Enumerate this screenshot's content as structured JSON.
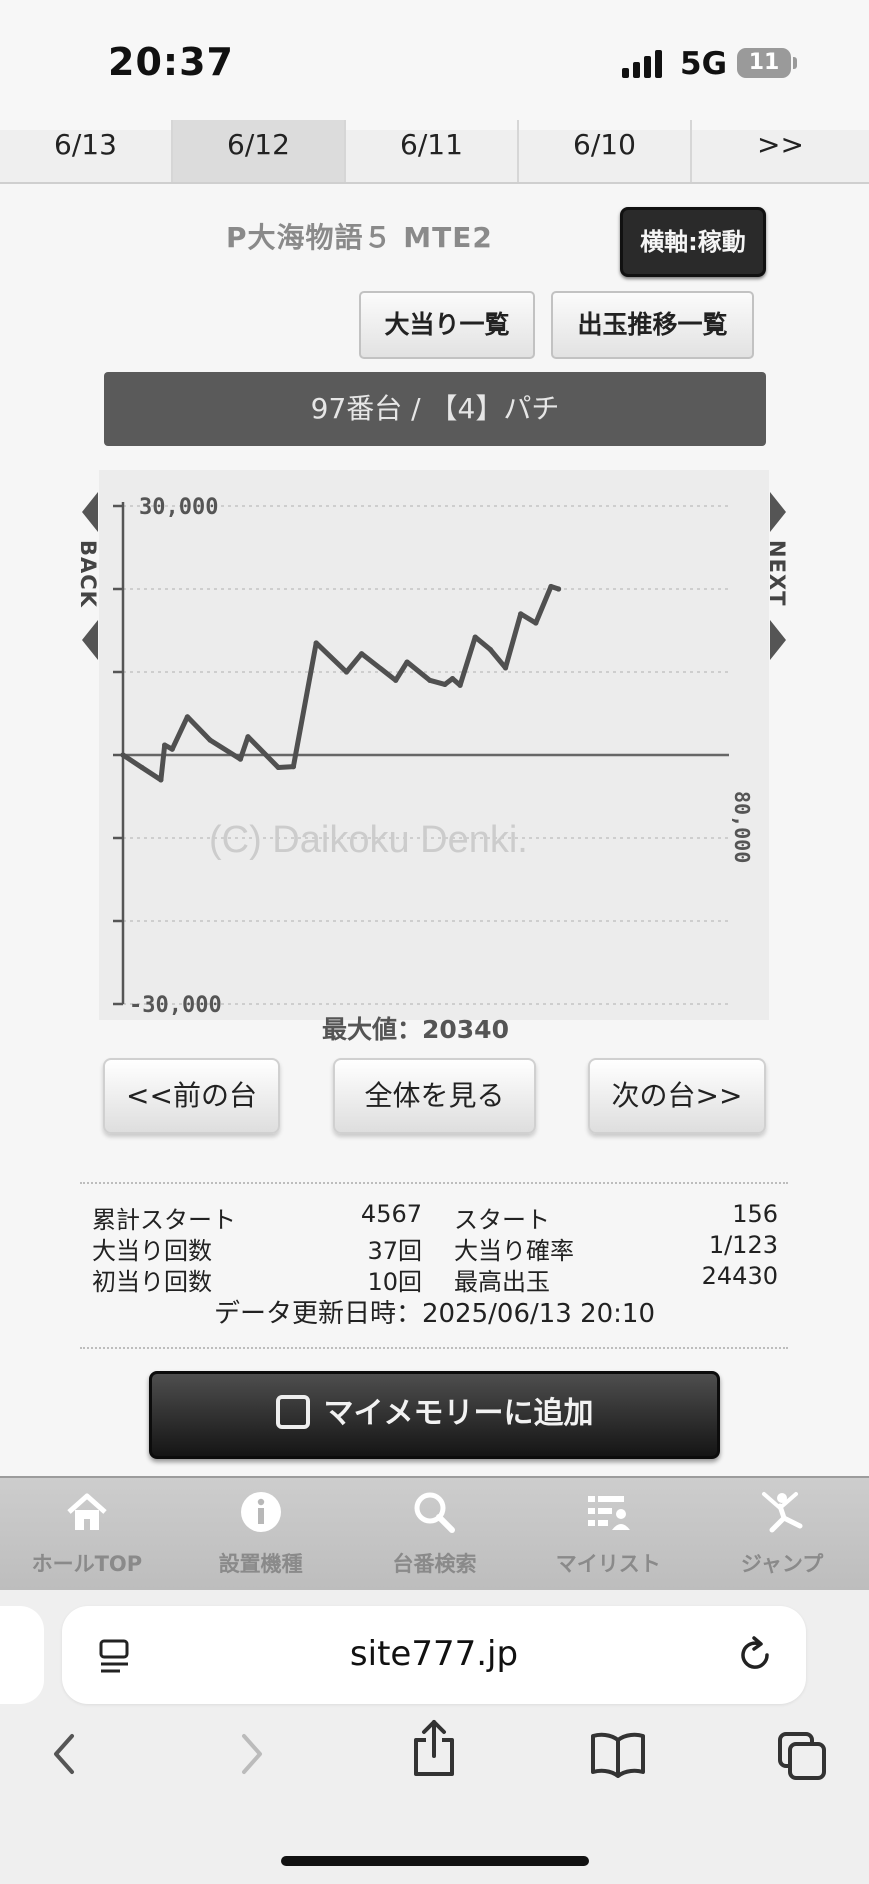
{
  "status_bar": {
    "time": "20:37",
    "network": "5G",
    "battery": "11"
  },
  "date_tabs": [
    {
      "label": "6/13"
    },
    {
      "label": "6/12"
    },
    {
      "label": "6/11"
    },
    {
      "label": "6/10"
    },
    {
      "label": ">>"
    }
  ],
  "model": {
    "title": "P大海物語５ MTE2",
    "axis_button": "横軸:稼動"
  },
  "actions": {
    "jackpot_list": "大当り一覧",
    "payout_list": "出玉推移一覧"
  },
  "machine_bar": "97番台 / 【4】パチ",
  "chart_side": {
    "back": "BACK",
    "next": "NEXT"
  },
  "chart_data": {
    "type": "line",
    "watermark": "(C) Daikoku Denki.",
    "y_tick_labels": [
      "30,000",
      "-30,000"
    ],
    "x_axis_end_label": "80,000",
    "ylim": [
      -30000,
      30000
    ],
    "xlim": [
      0,
      80000
    ],
    "gridlines": [
      -30000,
      -20000,
      -10000,
      0,
      10000,
      20000,
      30000
    ],
    "series": [
      {
        "points": [
          [
            0,
            0
          ],
          [
            2500,
            -1500
          ],
          [
            5000,
            -3000
          ],
          [
            5500,
            1200
          ],
          [
            6500,
            700
          ],
          [
            8500,
            4600
          ],
          [
            11500,
            1800
          ],
          [
            15500,
            -500
          ],
          [
            16500,
            2200
          ],
          [
            20500,
            -1500
          ],
          [
            22500,
            -1400
          ],
          [
            25500,
            13500
          ],
          [
            29500,
            10000
          ],
          [
            31500,
            12200
          ],
          [
            36000,
            9000
          ],
          [
            37500,
            11200
          ],
          [
            40500,
            9000
          ],
          [
            42500,
            8500
          ],
          [
            43500,
            9200
          ],
          [
            44500,
            8400
          ],
          [
            46500,
            14200
          ],
          [
            48500,
            12700
          ],
          [
            50500,
            10500
          ],
          [
            52500,
            17000
          ],
          [
            54500,
            15900
          ],
          [
            56500,
            20300
          ],
          [
            57500,
            20000
          ]
        ]
      }
    ],
    "max_label": "最大値：20340"
  },
  "nav_buttons": {
    "prev": "<<前の台",
    "all": "全体を見る",
    "next": "次の台>>"
  },
  "stats": {
    "rows": [
      {
        "k1": "累計スタート",
        "v1": "4567",
        "k2": "スタート",
        "v2": "156"
      },
      {
        "k1": "大当り回数",
        "v1": "37回",
        "k2": "大当り確率",
        "v2": "1/123"
      },
      {
        "k1": "初当り回数",
        "v1": "10回",
        "k2": "最高出玉",
        "v2": "24430"
      }
    ],
    "updated": "データ更新日時：2025/06/13 20:10"
  },
  "memory_button": "マイメモリーに追加",
  "site_nav": [
    {
      "label": "ホールTOP",
      "icon": "home-icon"
    },
    {
      "label": "設置機種",
      "icon": "info-icon"
    },
    {
      "label": "台番検索",
      "icon": "search-icon"
    },
    {
      "label": "マイリスト",
      "icon": "list-user-icon"
    },
    {
      "label": "ジャンプ",
      "icon": "jump-icon"
    }
  ],
  "browser": {
    "url": "site777.jp"
  }
}
